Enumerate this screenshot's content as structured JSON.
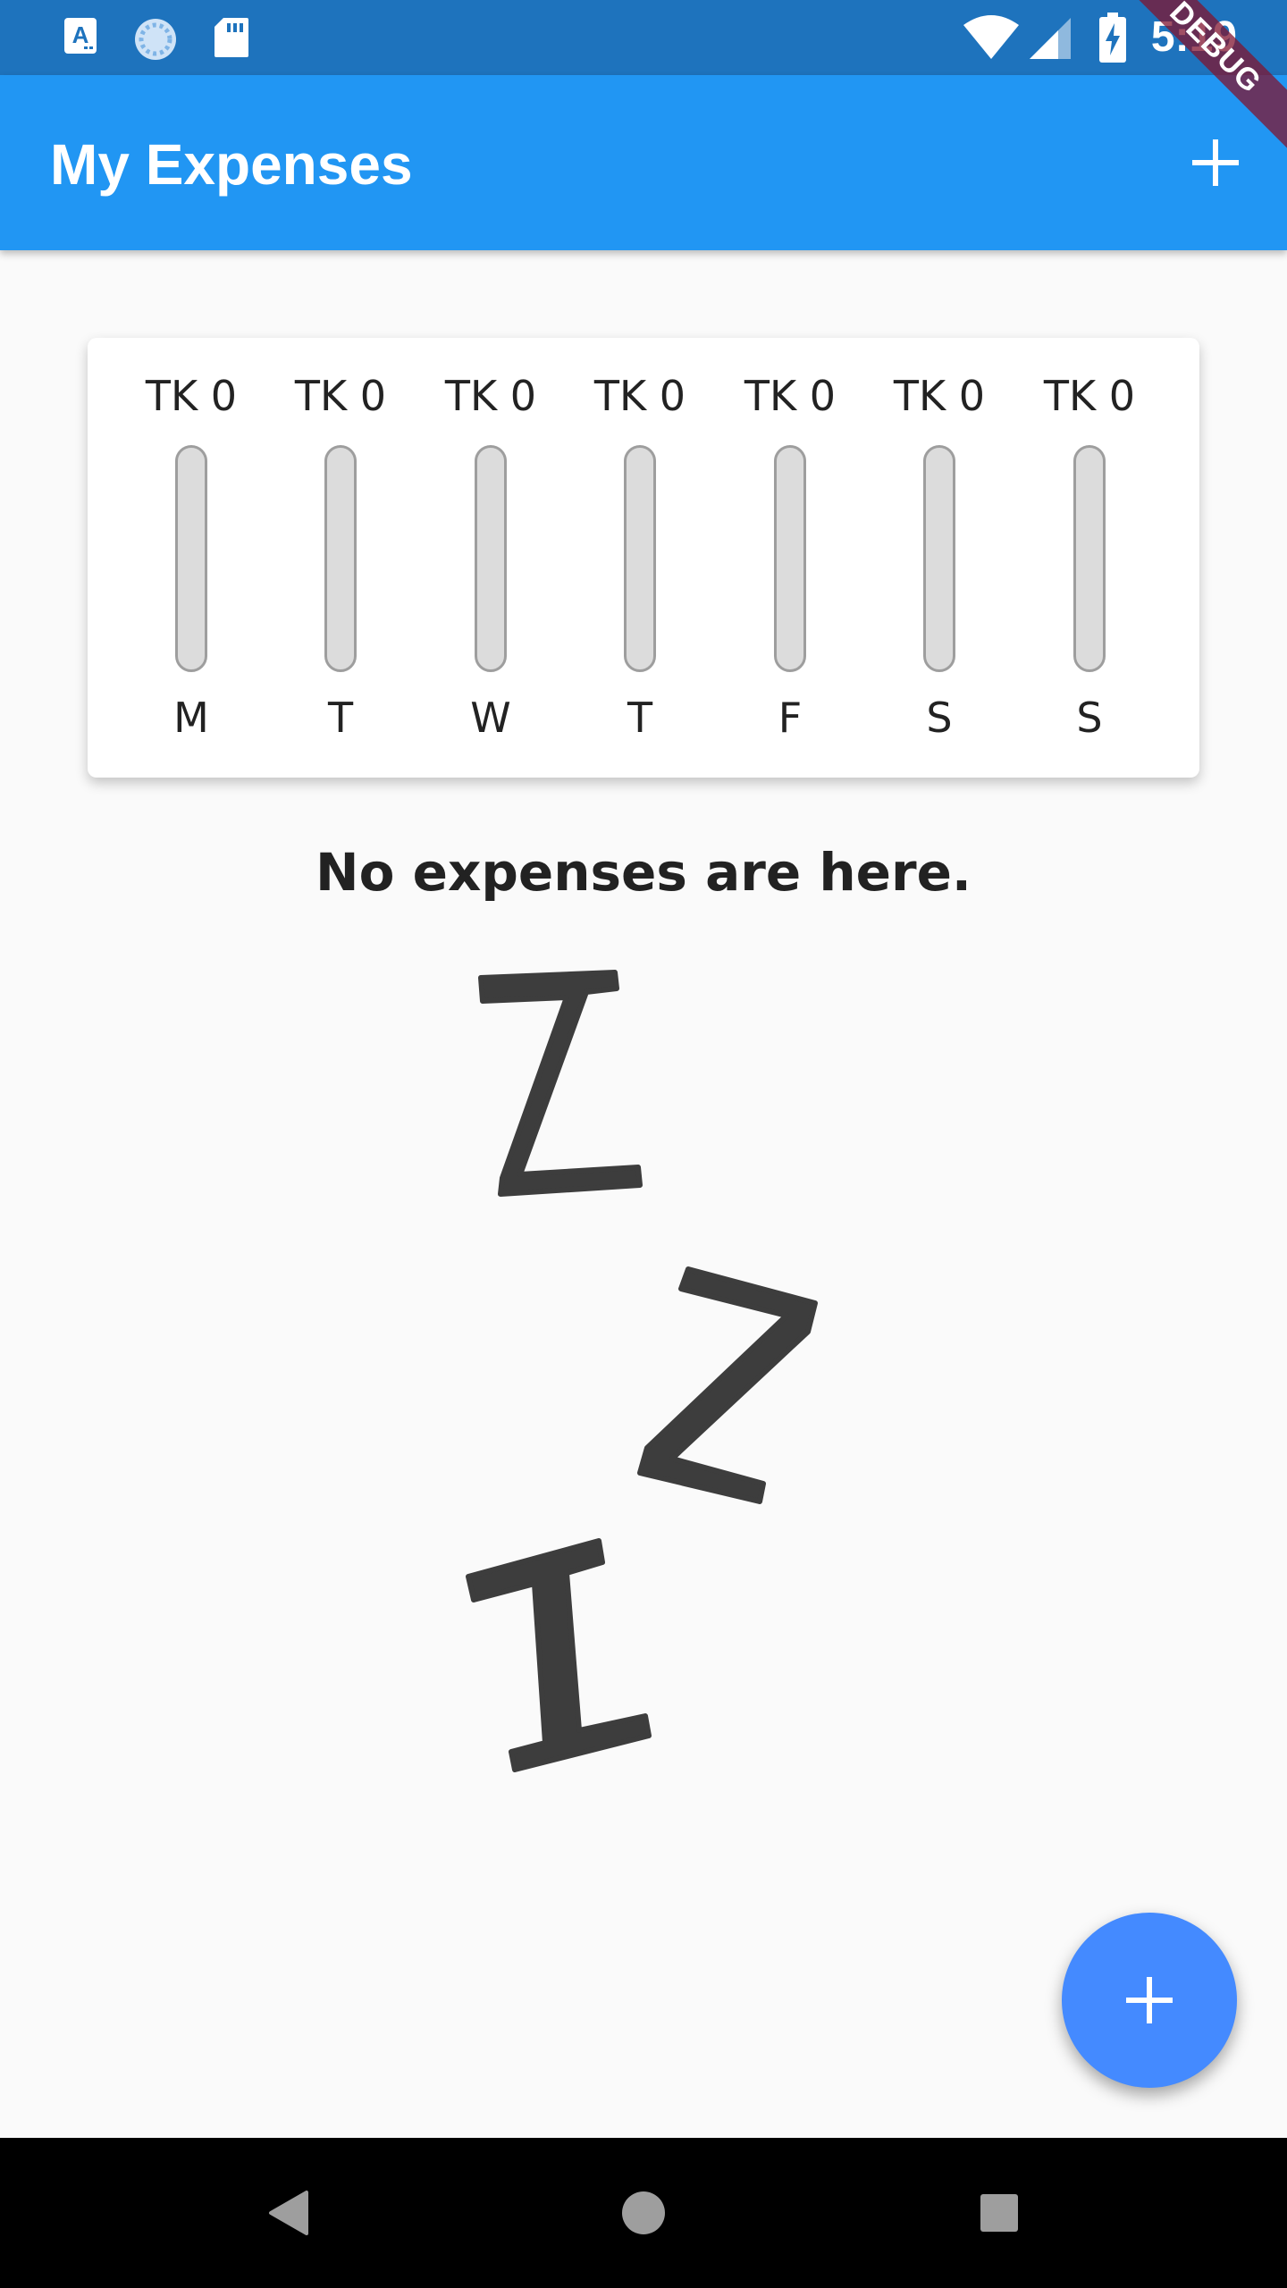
{
  "status_bar": {
    "time": "5:19",
    "icons": [
      "app-a-icon",
      "sync-icon",
      "sd-card-icon",
      "wifi-icon",
      "signal-icon",
      "battery-charging-icon"
    ]
  },
  "app_bar": {
    "title": "My Expenses",
    "action_icon": "add-icon"
  },
  "debug_banner": "DEBUG",
  "chart": {
    "bars": [
      {
        "day": "M",
        "amount_label": "TK 0",
        "fill_fraction": 0
      },
      {
        "day": "T",
        "amount_label": "TK 0",
        "fill_fraction": 0
      },
      {
        "day": "W",
        "amount_label": "TK 0",
        "fill_fraction": 0
      },
      {
        "day": "T",
        "amount_label": "TK 0",
        "fill_fraction": 0
      },
      {
        "day": "F",
        "amount_label": "TK 0",
        "fill_fraction": 0
      },
      {
        "day": "S",
        "amount_label": "TK 0",
        "fill_fraction": 0
      },
      {
        "day": "S",
        "amount_label": "TK 0",
        "fill_fraction": 0
      }
    ]
  },
  "empty_state": {
    "message": "No expenses are here.",
    "image_icon": "sleeping-zzz-icon"
  },
  "fab": {
    "icon": "add-icon"
  },
  "colors": {
    "primary": "#2196f3",
    "status_bar": "#1e73bd",
    "fab": "#448aff",
    "bar_track": "#dcdcdc",
    "background": "#fafafa"
  },
  "nav_bar": {
    "icons": [
      "back-icon",
      "home-icon",
      "recents-icon"
    ]
  }
}
